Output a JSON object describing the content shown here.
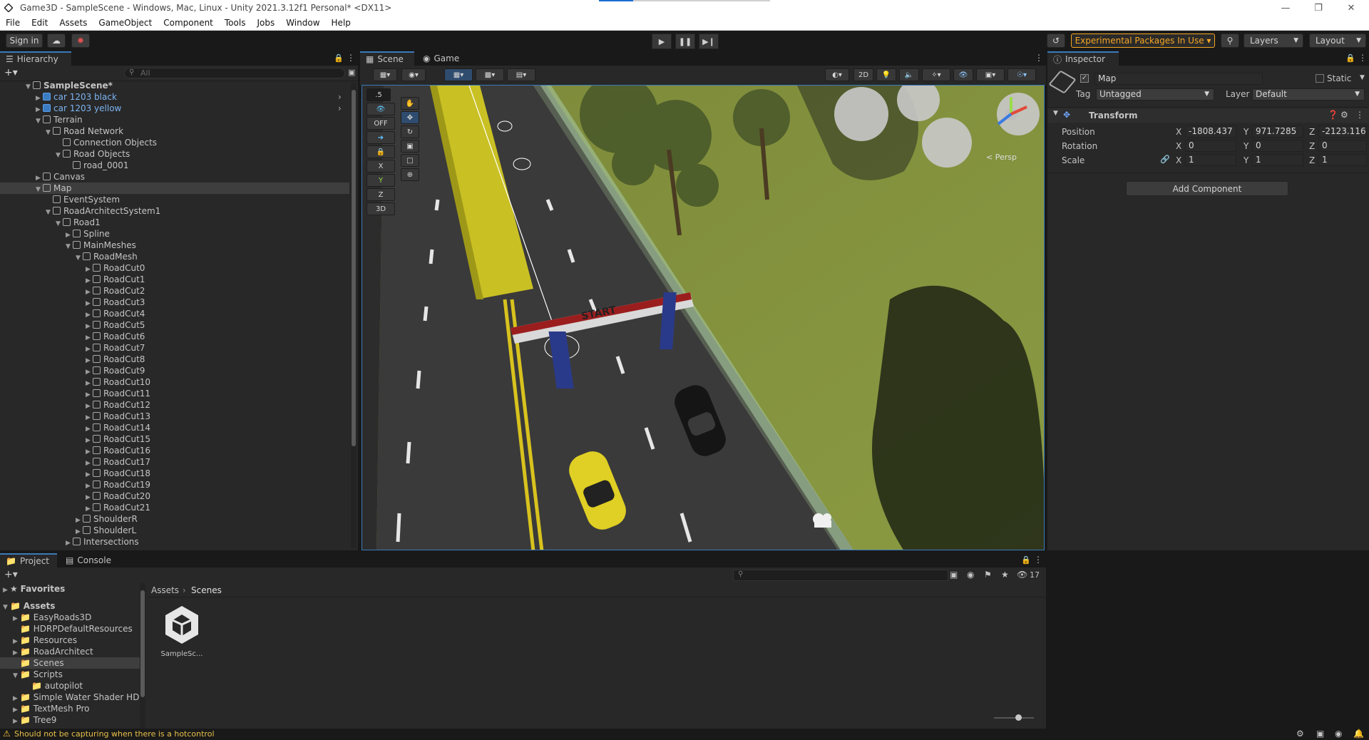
{
  "window": {
    "title": "Game3D - SampleScene - Windows, Mac, Linux - Unity 2021.3.12f1 Personal* <DX11>"
  },
  "menu": [
    "File",
    "Edit",
    "Assets",
    "GameObject",
    "Component",
    "Tools",
    "Jobs",
    "Window",
    "Help"
  ],
  "toolbar": {
    "sign_in": "Sign in",
    "experimental": "Experimental Packages In Use ▾",
    "layers": "Layers",
    "layout": "Layout"
  },
  "hierarchy": {
    "tab": "Hierarchy",
    "search_placeholder": "All",
    "rows": [
      {
        "label": "SampleScene*",
        "indent": 0,
        "arrow": "▼",
        "bold": true
      },
      {
        "label": "car 1203 black",
        "indent": 1,
        "arrow": "▶",
        "blue": true
      },
      {
        "label": "car 1203 yellow",
        "indent": 1,
        "arrow": "▶",
        "blue": true
      },
      {
        "label": "Terrain",
        "indent": 1,
        "arrow": "▼"
      },
      {
        "label": "Road Network",
        "indent": 2,
        "arrow": "▼"
      },
      {
        "label": "Connection Objects",
        "indent": 3,
        "arrow": ""
      },
      {
        "label": "Road Objects",
        "indent": 3,
        "arrow": "▼"
      },
      {
        "label": "road_0001",
        "indent": 4,
        "arrow": ""
      },
      {
        "label": "Canvas",
        "indent": 1,
        "arrow": "▶"
      },
      {
        "label": "Map",
        "indent": 1,
        "arrow": "▼",
        "sel": true
      },
      {
        "label": "EventSystem",
        "indent": 2,
        "arrow": ""
      },
      {
        "label": "RoadArchitectSystem1",
        "indent": 2,
        "arrow": "▼"
      },
      {
        "label": "Road1",
        "indent": 3,
        "arrow": "▼"
      },
      {
        "label": "Spline",
        "indent": 4,
        "arrow": "▶"
      },
      {
        "label": "MainMeshes",
        "indent": 4,
        "arrow": "▼"
      },
      {
        "label": "RoadMesh",
        "indent": 5,
        "arrow": "▼"
      },
      {
        "label": "RoadCut0",
        "indent": 6,
        "arrow": "▶"
      },
      {
        "label": "RoadCut1",
        "indent": 6,
        "arrow": "▶"
      },
      {
        "label": "RoadCut2",
        "indent": 6,
        "arrow": "▶"
      },
      {
        "label": "RoadCut3",
        "indent": 6,
        "arrow": "▶"
      },
      {
        "label": "RoadCut4",
        "indent": 6,
        "arrow": "▶"
      },
      {
        "label": "RoadCut5",
        "indent": 6,
        "arrow": "▶"
      },
      {
        "label": "RoadCut6",
        "indent": 6,
        "arrow": "▶"
      },
      {
        "label": "RoadCut7",
        "indent": 6,
        "arrow": "▶"
      },
      {
        "label": "RoadCut8",
        "indent": 6,
        "arrow": "▶"
      },
      {
        "label": "RoadCut9",
        "indent": 6,
        "arrow": "▶"
      },
      {
        "label": "RoadCut10",
        "indent": 6,
        "arrow": "▶"
      },
      {
        "label": "RoadCut11",
        "indent": 6,
        "arrow": "▶"
      },
      {
        "label": "RoadCut12",
        "indent": 6,
        "arrow": "▶"
      },
      {
        "label": "RoadCut13",
        "indent": 6,
        "arrow": "▶"
      },
      {
        "label": "RoadCut14",
        "indent": 6,
        "arrow": "▶"
      },
      {
        "label": "RoadCut15",
        "indent": 6,
        "arrow": "▶"
      },
      {
        "label": "RoadCut16",
        "indent": 6,
        "arrow": "▶"
      },
      {
        "label": "RoadCut17",
        "indent": 6,
        "arrow": "▶"
      },
      {
        "label": "RoadCut18",
        "indent": 6,
        "arrow": "▶"
      },
      {
        "label": "RoadCut19",
        "indent": 6,
        "arrow": "▶"
      },
      {
        "label": "RoadCut20",
        "indent": 6,
        "arrow": "▶"
      },
      {
        "label": "RoadCut21",
        "indent": 6,
        "arrow": "▶"
      },
      {
        "label": "ShoulderR",
        "indent": 5,
        "arrow": "▶"
      },
      {
        "label": "ShoulderL",
        "indent": 5,
        "arrow": "▶"
      },
      {
        "label": "Intersections",
        "indent": 4,
        "arrow": "▶"
      }
    ]
  },
  "scene": {
    "tab_scene": "Scene",
    "tab_game": "Game",
    "view_2d": "2D",
    "persp": "< Persp",
    "start_banner": "START",
    "snap_value": ".5",
    "off_label": "OFF",
    "axis_x": "X",
    "axis_y": "Y",
    "axis_z": "Z",
    "mode_3d": "3D"
  },
  "inspector": {
    "tab": "Inspector",
    "object_name": "Map",
    "static_label": "Static",
    "tag_label": "Tag",
    "tag_value": "Untagged",
    "layer_label": "Layer",
    "layer_value": "Default",
    "component": "Transform",
    "position_label": "Position",
    "rotation_label": "Rotation",
    "scale_label": "Scale",
    "position": {
      "x": "-1808.437",
      "y": "971.7285",
      "z": "-2123.116"
    },
    "rotation": {
      "x": "0",
      "y": "0",
      "z": "0"
    },
    "scale": {
      "x": "1",
      "y": "1",
      "z": "1"
    },
    "add_component": "Add Component"
  },
  "project": {
    "tab_project": "Project",
    "tab_console": "Console",
    "favorites": "Favorites",
    "assets": "Assets",
    "folders": [
      "EasyRoads3D",
      "HDRPDefaultResources",
      "Resources",
      "RoadArchitect",
      "Scenes",
      "Scripts",
      "autopilot",
      "Simple Water Shader HDRP",
      "TextMesh Pro",
      "Tree9"
    ],
    "breadcrumb": [
      "Assets",
      "Scenes"
    ],
    "asset_label": "SampleSc...",
    "hidden_count": "17"
  },
  "status": {
    "message": "Should not be capturing when there is a hotcontrol"
  }
}
